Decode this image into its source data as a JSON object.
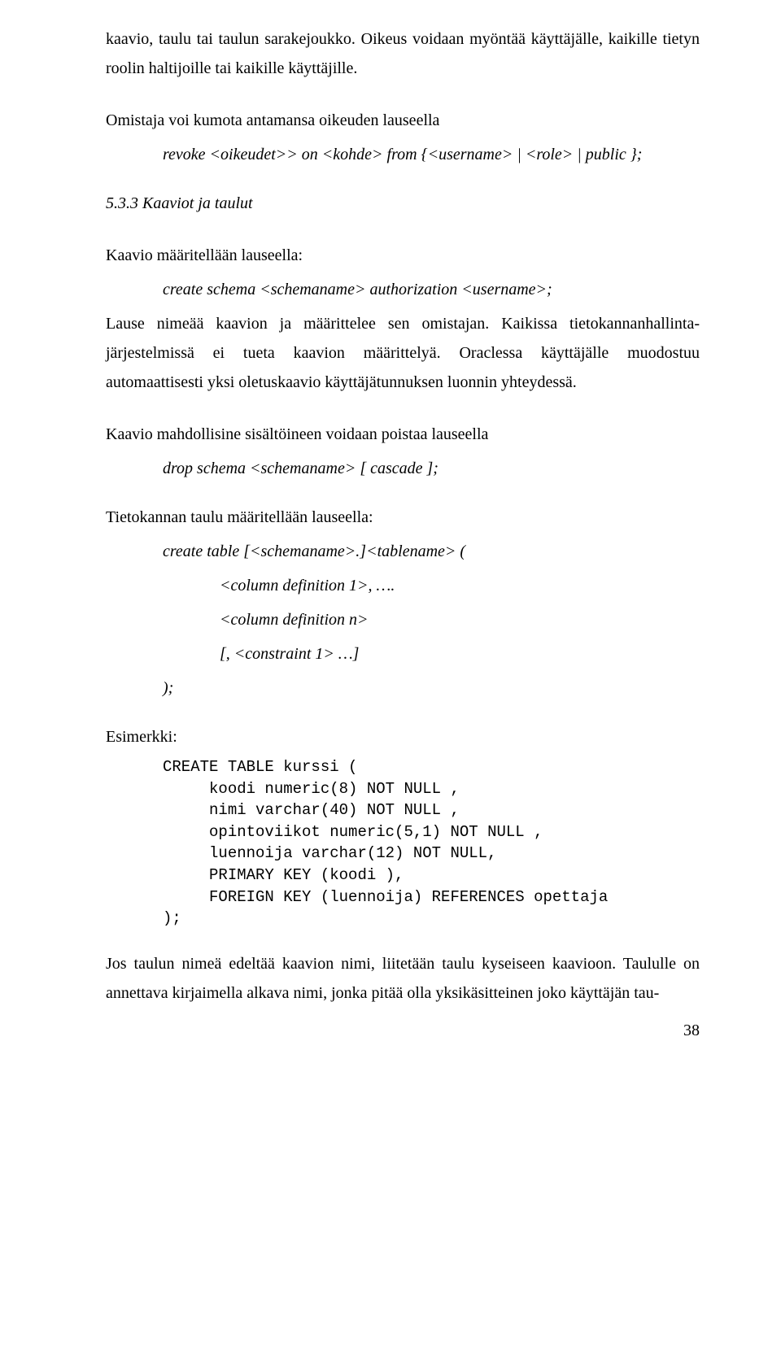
{
  "p1": "kaavio, taulu tai taulun sarakejoukko. Oikeus voidaan myöntää käyttäjälle, kaikille tietyn roolin haltijoille tai kaikille käyttäjille.",
  "p2": "Omistaja voi kumota antamansa oikeuden lauseella",
  "p2_code": "revoke <oikeudet>> on <kohde> from {<username> | <role> | public };",
  "section": "5.3.3 Kaaviot ja taulut",
  "p3a": "Kaavio määritellään lauseella:",
  "p3_code": "create schema <schemaname> authorization <username>;",
  "p3b": "Lause nimeää kaavion ja määrittelee sen omistajan. Kaikissa tietokannanhallinta­järjestelmissä ei tueta kaavion määrittelyä. Oraclessa käyttäjälle muodostuu automaattisesti yksi oletuskaavio käyttäjätunnuksen luonnin yhteydessä.",
  "p4": "Kaavio mahdollisine sisältöineen voidaan poistaa lauseella",
  "p4_code": "drop schema <schemaname> [ cascade ];",
  "p5": "Tietokannan taulu määritellään lauseella:",
  "p5_code_l1": "create table [<schemaname>.]<tablename> (",
  "p5_code_l2": "<column definition 1>, ….",
  "p5_code_l3": "<column definition n>",
  "p5_code_l4": "[, <constraint 1> …]",
  "p5_code_l5": ");",
  "example_label": "Esimerkki:",
  "example_code": "CREATE TABLE kurssi (\n     koodi numeric(8) NOT NULL ,\n     nimi varchar(40) NOT NULL ,\n     opintoviikot numeric(5,1) NOT NULL ,\n     luennoija varchar(12) NOT NULL,\n     PRIMARY KEY (koodi ),\n     FOREIGN KEY (luennoija) REFERENCES opettaja\n);",
  "p6": "Jos taulun nimeä edeltää kaavion nimi, liitetään taulu kyseiseen kaavioon. Taululle on annettava kirjaimella alkava nimi, jonka pitää olla yksikäsitteinen joko käyttäjän tau-",
  "page_number": "38"
}
